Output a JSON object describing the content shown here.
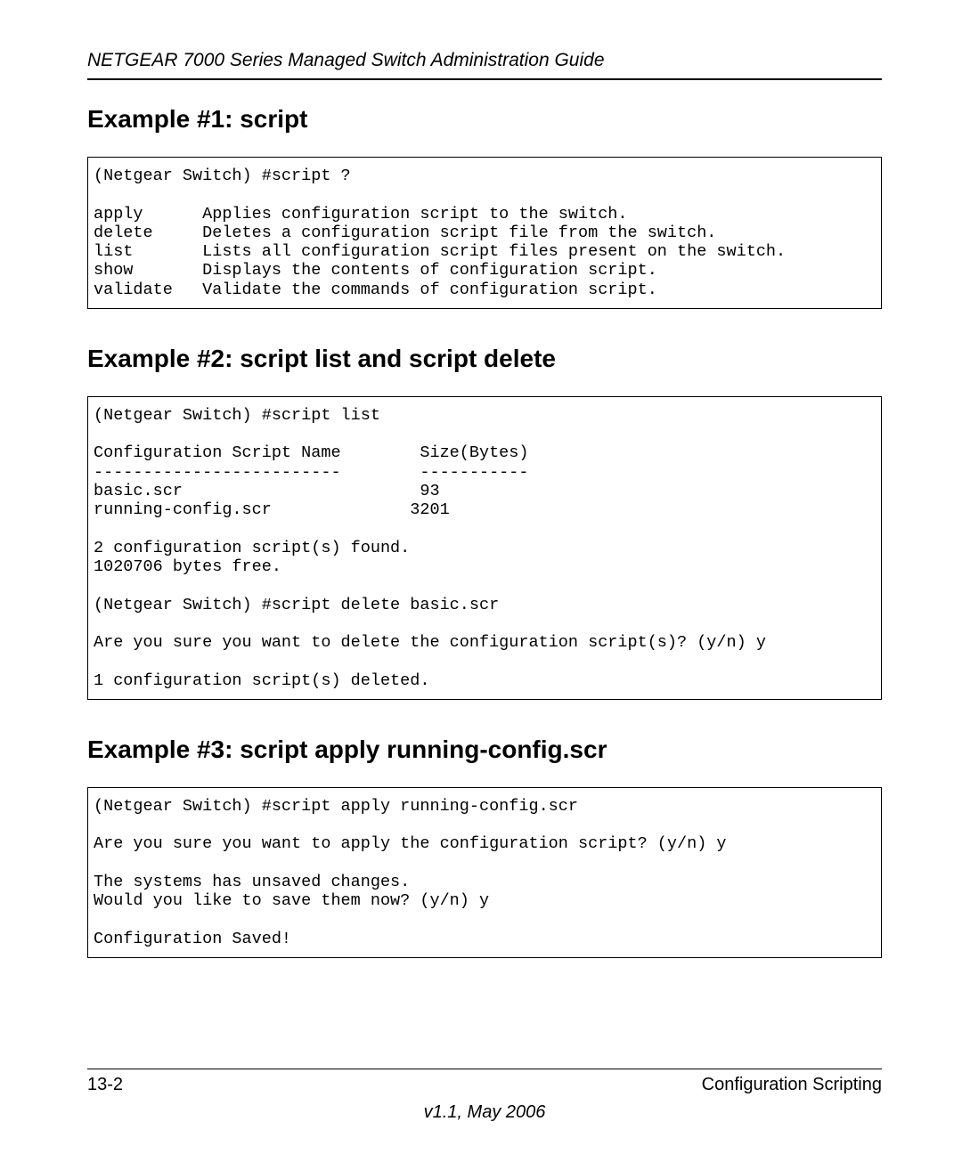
{
  "header": {
    "title": "NETGEAR 7000  Series Managed Switch Administration Guide"
  },
  "sections": {
    "s1": {
      "heading": "Example #1: script",
      "code": "(Netgear Switch) #script ?\n\napply      Applies configuration script to the switch.\ndelete     Deletes a configuration script file from the switch.\nlist       Lists all configuration script files present on the switch.\nshow       Displays the contents of configuration script.\nvalidate   Validate the commands of configuration script."
    },
    "s2": {
      "heading": "Example #2: script list and script delete",
      "code": "(Netgear Switch) #script list\n\nConfiguration Script Name        Size(Bytes)\n-------------------------        -----------\nbasic.scr                        93\nrunning-config.scr              3201\n\n2 configuration script(s) found.\n1020706 bytes free.\n\n(Netgear Switch) #script delete basic.scr\n\nAre you sure you want to delete the configuration script(s)? (y/n) y\n\n1 configuration script(s) deleted.\n"
    },
    "s3": {
      "heading": "Example #3: script apply running-config.scr",
      "code": "(Netgear Switch) #script apply running-config.scr\n\nAre you sure you want to apply the configuration script? (y/n) y\n\nThe systems has unsaved changes.\nWould you like to save them now? (y/n) y\n\nConfiguration Saved!"
    }
  },
  "footer": {
    "page_num": "13-2",
    "section": "Configuration Scripting",
    "version": "v1.1, May 2006"
  }
}
